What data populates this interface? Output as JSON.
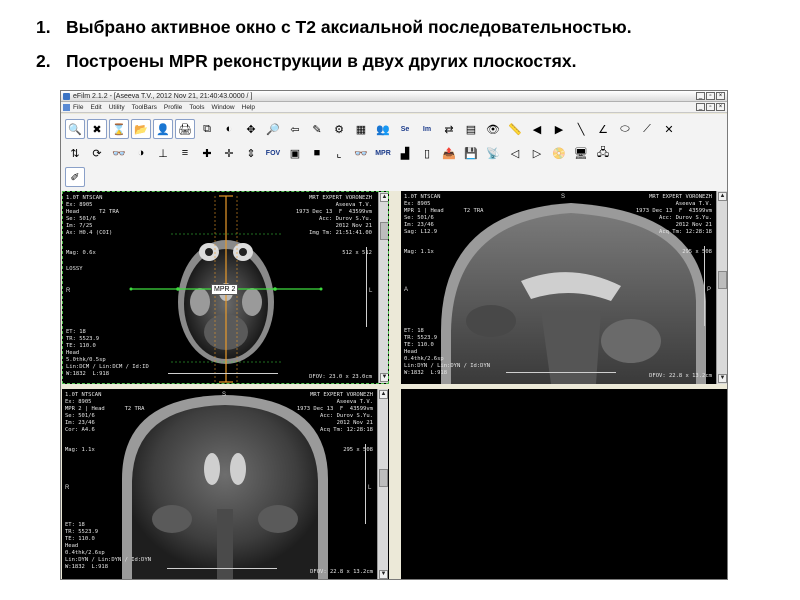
{
  "slide": {
    "items": [
      {
        "num": "1.",
        "text": "Выбрано активное окно с Т2 аксиальной последовательностью."
      },
      {
        "num": "2.",
        "text": "Построены MPR реконструкции в двух других плоскостях."
      }
    ]
  },
  "window": {
    "title": "eFilm 2.1.2 - [Aseeva T.V., 2012 Nov 21, 21:40:43.0000  /  ]",
    "menu": [
      "File",
      "Edit",
      "Utility",
      "ToolBars",
      "Profile",
      "Tools",
      "Window",
      "Help"
    ],
    "buttons": [
      "_",
      "▫",
      "×"
    ]
  },
  "toolbar": {
    "row1": [
      {
        "name": "search-study-icon",
        "glyph": "🔍",
        "framed": true
      },
      {
        "name": "close-study-icon",
        "glyph": "✖",
        "framed": true
      },
      {
        "name": "hourglass-icon",
        "glyph": "⌛",
        "framed": true
      },
      {
        "name": "open-folder-icon",
        "glyph": "📂",
        "framed": true
      },
      {
        "name": "patient-info-icon",
        "glyph": "👤",
        "framed": true
      },
      {
        "name": "print-icon",
        "glyph": "🖨",
        "framed": true
      },
      {
        "name": "layout-icon",
        "glyph": "⧉",
        "framed": false
      },
      {
        "name": "window-level-icon",
        "glyph": "◐",
        "framed": false
      },
      {
        "name": "pan-icon",
        "glyph": "✥",
        "framed": false
      },
      {
        "name": "zoom-icon",
        "glyph": "🔎",
        "framed": false
      },
      {
        "name": "arrow-icon",
        "glyph": "⇦",
        "framed": false
      },
      {
        "name": "annotate-icon",
        "glyph": "✎",
        "framed": false
      },
      {
        "name": "cine-icon",
        "glyph": "⚙",
        "framed": false
      },
      {
        "name": "tile-icon",
        "glyph": "▦",
        "framed": false
      },
      {
        "name": "compare-icon",
        "glyph": "👥",
        "framed": false
      },
      {
        "name": "series-icon",
        "text": "Se",
        "framed": false
      },
      {
        "name": "image-icon",
        "text": "Im",
        "framed": false
      },
      {
        "name": "sync-icon",
        "glyph": "⇄",
        "framed": false
      },
      {
        "name": "stack-icon",
        "glyph": "▤",
        "framed": false
      },
      {
        "name": "eye-icon",
        "glyph": "👁",
        "framed": false
      },
      {
        "name": "measure-icon",
        "glyph": "📏",
        "framed": false
      },
      {
        "name": "prev-icon",
        "glyph": "◀",
        "framed": false
      },
      {
        "name": "next-icon",
        "glyph": "▶",
        "framed": false
      },
      {
        "name": "line-icon",
        "glyph": "╲",
        "framed": false
      },
      {
        "name": "angle-icon",
        "glyph": "∠",
        "framed": false
      },
      {
        "name": "roi-icon",
        "glyph": "⬭",
        "framed": false
      },
      {
        "name": "cobb-icon",
        "glyph": "⟋",
        "framed": false
      },
      {
        "name": "delete-annotation-icon",
        "glyph": "✕",
        "framed": false
      }
    ],
    "row2": [
      {
        "name": "flip-icon",
        "glyph": "⇅",
        "framed": false
      },
      {
        "name": "rotate-icon",
        "glyph": "⟳",
        "framed": false
      },
      {
        "name": "glasses-icon",
        "glyph": "👓",
        "framed": false
      },
      {
        "name": "invert-icon",
        "glyph": "◑",
        "framed": false
      },
      {
        "name": "mpr-axis-icon",
        "glyph": "⊥",
        "framed": false
      },
      {
        "name": "mpr-slab-icon",
        "glyph": "≡",
        "framed": false
      },
      {
        "name": "crosshair-icon",
        "glyph": "✚",
        "framed": false
      },
      {
        "name": "move-icon",
        "glyph": "✛",
        "framed": false
      },
      {
        "name": "move-vertical-icon",
        "glyph": "⇕",
        "framed": false
      },
      {
        "name": "fov-icon",
        "text": "FOV",
        "framed": false
      },
      {
        "name": "3d-icon",
        "glyph": "▣",
        "framed": false
      },
      {
        "name": "gray-square-icon",
        "glyph": "■",
        "framed": false
      },
      {
        "name": "axis-icon",
        "glyph": "⌞",
        "framed": false
      },
      {
        "name": "glasses-2-icon",
        "glyph": "👓",
        "framed": false
      },
      {
        "name": "mpr-icon",
        "text": "MPR",
        "framed": false
      },
      {
        "name": "histogram-icon",
        "glyph": "▟",
        "framed": false
      },
      {
        "name": "ruler-icon",
        "glyph": "▯",
        "framed": false
      },
      {
        "name": "export-icon",
        "glyph": "📤",
        "framed": false
      },
      {
        "name": "save-icon",
        "glyph": "💾",
        "framed": false
      },
      {
        "name": "send-icon",
        "glyph": "📡",
        "framed": false
      },
      {
        "name": "back-icon",
        "glyph": "◁",
        "framed": false
      },
      {
        "name": "forward-icon",
        "glyph": "▷",
        "framed": false
      },
      {
        "name": "burn-icon",
        "glyph": "📀",
        "framed": false
      },
      {
        "name": "pc-icon",
        "glyph": "🖥",
        "framed": false
      },
      {
        "name": "network-icon",
        "glyph": "🖧",
        "framed": false
      }
    ],
    "row3": [
      {
        "name": "magic-wand-icon",
        "glyph": "✐",
        "framed": true
      }
    ]
  },
  "viewports": {
    "axial": {
      "top_left": "1.0T NTSCAN\nEx: 8905\nHead      T2 TRA\nSe: 501/6\nIm: 7/25\nAx: H0.4 (COI)",
      "mag": "Mag: 0.6x",
      "lossy": "LOSSY",
      "top_right": "MRT EXPERT VORONEZH\nAseeva T.V.\n1973 Dec 13  F  43599vm\nAcc: Durov S.Yu.\n2012 Nov 21\nImg Tm: 21:51:41.00",
      "matrix": "512 x 512",
      "bottom_left": "ET: 18\nTR: 5523.9\nTE: 110.0\nHead\n5.0thk/0.5sp\nLin:DCM / Lin:DCM / Id:ID\nW:1832  L:918",
      "bottom_right": "DFOV: 23.0 x 23.0cm",
      "left_marker": "R",
      "right_marker": "L",
      "mpr_label": "MPR 2"
    },
    "sagittal": {
      "top_left": "1.0T NTSCAN\nEx: 8905\nMPR 1 | Head      T2 TRA\nSe: 501/6\nIm: 23/46\nSag: L12.9",
      "mag": "Mag: 1.1x",
      "top_right": "MRT EXPERT VORONEZH\nAseeva T.V.\n1973 Dec 13  F  43599vm\nAcc: Durov S.Yu.\n2012 Nov 21\nAcq Tm: 12:28:18",
      "matrix": "295 x 508",
      "bottom_left": "ET: 18\nTR: 5523.9\nTE: 110.0\nHead\n0.4thk/2.6sp\nLin:DYN / Lin:DYN / Id:DYN\nW:1832  L:918",
      "bottom_right": "DFOV: 22.8 x 13.2cm",
      "left_marker": "A",
      "right_marker": "P",
      "top_marker": "S"
    },
    "coronal": {
      "top_left": "1.0T NTSCAN\nEx: 8905\nMPR 2 | Head      T2 TRA\nSe: 501/6\nIm: 23/46\nCor: A4.6",
      "mag": "Mag: 1.1x",
      "top_right": "MRT EXPERT VORONEZH\nAseeva T.V.\n1973 Dec 13  F  43599vm\nAcc: Durov S.Yu.\n2012 Nov 21\nAcq Tm: 12:28:18",
      "matrix": "295 x 508",
      "bottom_left": "ET: 18\nTR: 5523.9\nTE: 110.0\nHead\n0.4thk/2.6sp\nLin:DYN / Lin:DYN / Id:DYN\nW:1832  L:918",
      "bottom_right": "DFOV: 22.8 x 13.2cm",
      "left_marker": "R",
      "right_marker": "L",
      "top_marker": "S"
    }
  },
  "colors": {
    "crosshair_green": "#3fdc3f",
    "crosshair_orange": "#e89a2a",
    "active_border": "#4cbf4c"
  }
}
